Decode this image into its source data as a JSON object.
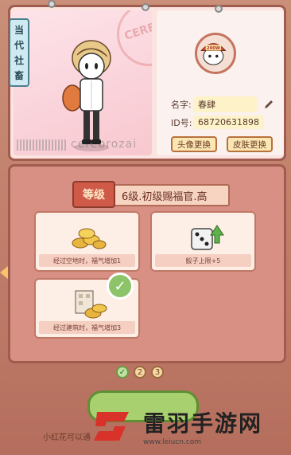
{
  "tag": {
    "chars": [
      "当",
      "代",
      "社",
      "畜"
    ]
  },
  "watermark": "cerebrozai",
  "stamp": "CERE",
  "avatar_badge": "200W",
  "profile": {
    "name_label": "名字:",
    "name_value": "春肆",
    "id_label": "ID号:",
    "id_value": "68720631898",
    "btn_avatar": "头像更换",
    "btn_skin": "皮肤更换"
  },
  "level": {
    "badge": "等级",
    "title": "6级.初级赐福官.高"
  },
  "skills": [
    {
      "caption": "经过空地时，福气增加1"
    },
    {
      "caption": "骰子上限+5"
    },
    {
      "caption": "经过建筑时，福气增加3"
    }
  ],
  "pager": [
    "✓",
    "2",
    "3"
  ],
  "footer_note": "小红花可以通",
  "brand": {
    "name": "雷羽手游网",
    "url": "www.leiucn.com"
  },
  "colors": {
    "panel_border": "#a25b4f",
    "accent_red": "#d05a48",
    "accent_green": "#8dc46a"
  }
}
